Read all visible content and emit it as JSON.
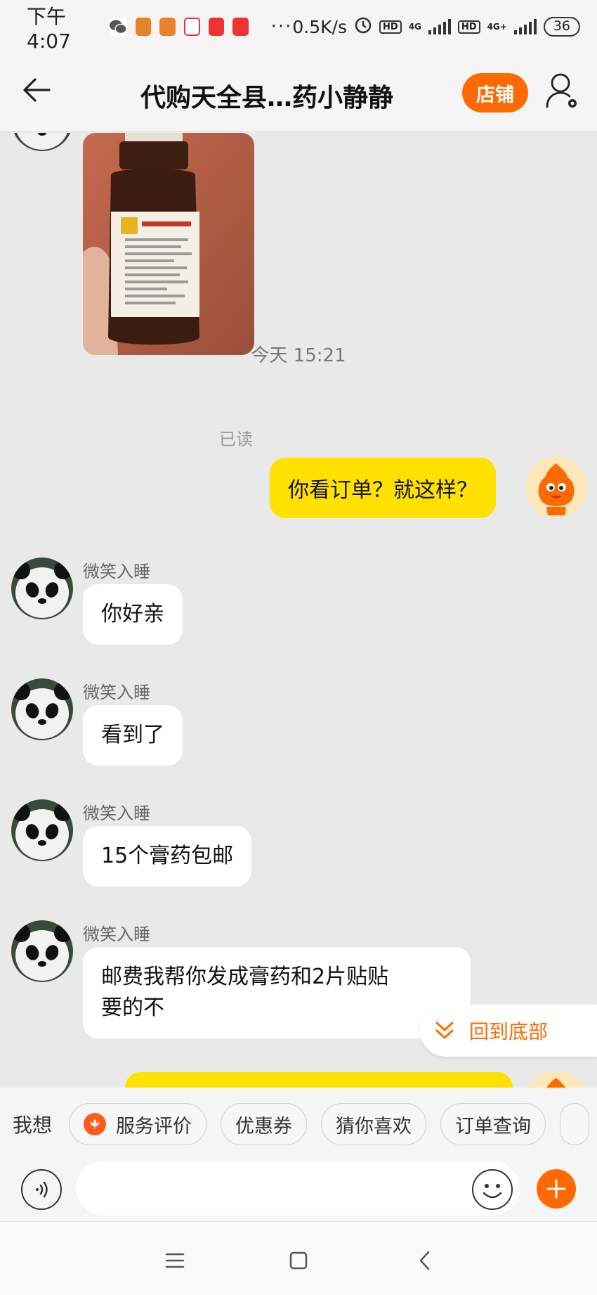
{
  "status_bar": {
    "time": "下午4:07",
    "network_speed": "0.5K/s",
    "hd1": "HD",
    "net1": "4G",
    "hd2": "HD",
    "net2": "4G+",
    "battery": "36"
  },
  "header": {
    "title": "代购天全县…药小静静",
    "shop_button": "店铺"
  },
  "chat": {
    "time_separator": "今天  15:21",
    "outgoing_1": {
      "text": "你看订单？就这样？",
      "read_status": "已读"
    },
    "incoming": [
      {
        "sender": "微笑入睡",
        "text": "你好亲"
      },
      {
        "sender": "微笑入睡",
        "text": "看到了"
      },
      {
        "sender": "微笑入睡",
        "text": "15个膏药包邮"
      },
      {
        "sender": "微笑入睡",
        "text_line1": "邮费我帮你发成膏药和2片贴贴",
        "text_line2": "要的不"
      }
    ],
    "back_to_bottom": "回到底部"
  },
  "quick_bar": {
    "label": "我想",
    "chips": [
      "服务评价",
      "优惠券",
      "猜你喜欢",
      "订单查询"
    ]
  },
  "input": {
    "placeholder": ""
  },
  "colors": {
    "accent": "#ff6a00",
    "outgoing_bubble": "#ffe100",
    "chat_bg": "#e9e9e9"
  }
}
